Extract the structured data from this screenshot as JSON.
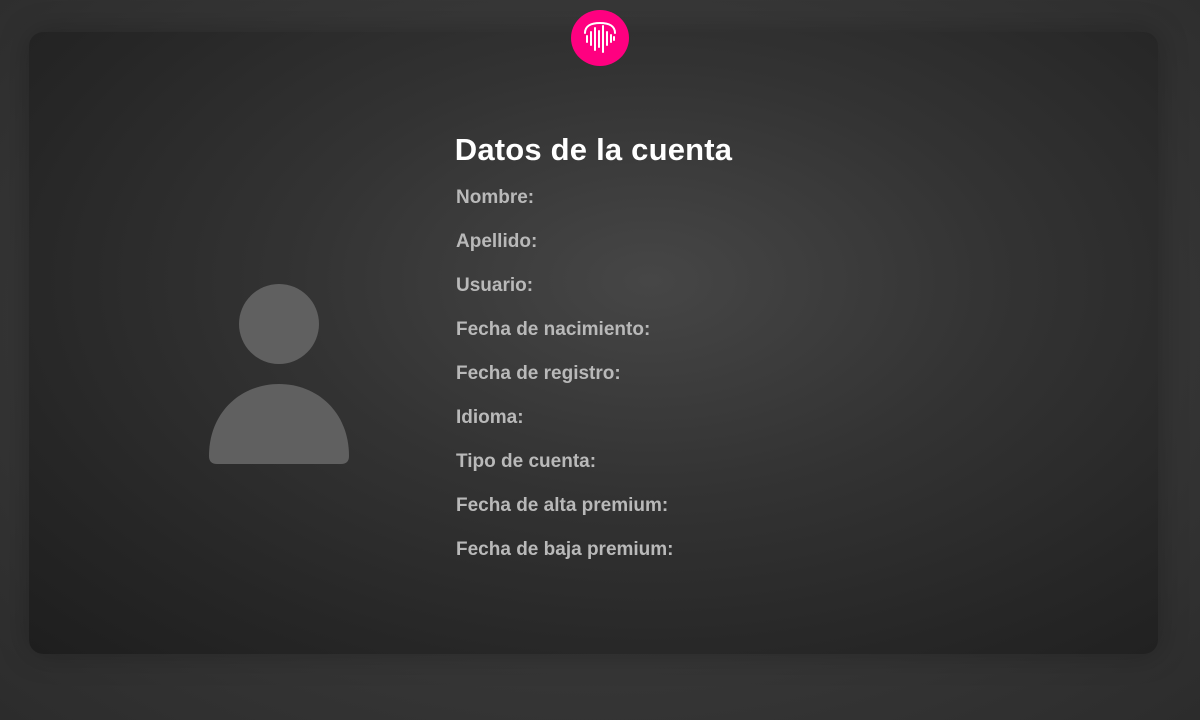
{
  "app": {
    "logo_icon": "sound-wave-icon",
    "accent_color": "#ff0080"
  },
  "page": {
    "title": "Datos de la cuenta"
  },
  "profile": {
    "avatar_icon": "user-avatar-icon",
    "fields": [
      {
        "label": "Nombre:"
      },
      {
        "label": "Apellido:"
      },
      {
        "label": "Usuario:"
      },
      {
        "label": "Fecha de nacimiento:"
      },
      {
        "label": "Fecha de registro:"
      },
      {
        "label": "Idioma:"
      },
      {
        "label": "Tipo de cuenta:"
      },
      {
        "label": "Fecha de alta premium:"
      },
      {
        "label": "Fecha de baja premium:"
      }
    ]
  }
}
